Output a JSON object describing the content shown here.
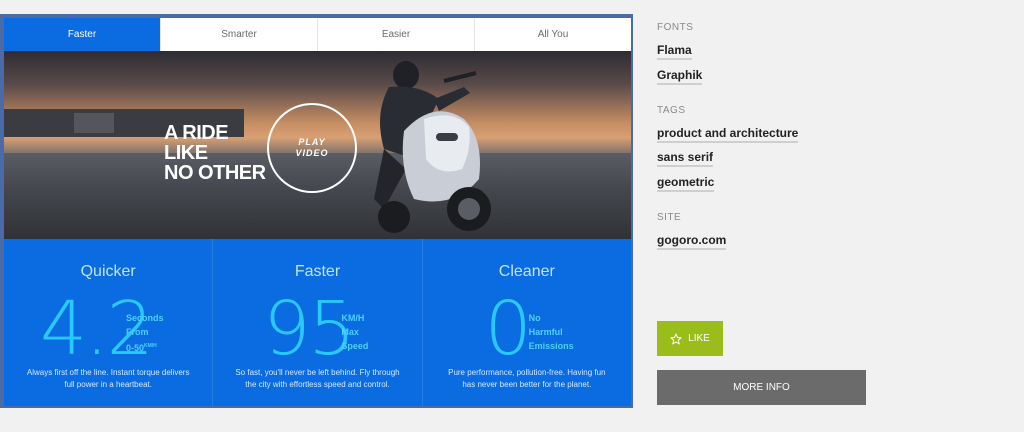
{
  "preview": {
    "tabs": [
      "Faster",
      "Smarter",
      "Easier",
      "All You"
    ],
    "active_tab_index": 0,
    "hero": {
      "title_lines": [
        "A RIDE",
        "LIKE",
        "NO OTHER"
      ],
      "play_label_lines": [
        "PLAY",
        "VIDEO"
      ]
    },
    "stats": [
      {
        "title": "Quicker",
        "number": "4.2",
        "unit_lines": [
          "Seconds",
          "From",
          "0-50"
        ],
        "unit_superscript": "KM/H",
        "description_lines": [
          "Always first off the line. Instant torque delivers",
          "full power in a heartbeat."
        ]
      },
      {
        "title": "Faster",
        "number": "95",
        "unit_lines": [
          "KM/H",
          "Max",
          "Speed"
        ],
        "description_lines": [
          "So fast, you'll never be left behind. Fly through",
          "the city with effortless speed and control."
        ]
      },
      {
        "title": "Cleaner",
        "number": "0",
        "unit_lines": [
          "No",
          "Harmful",
          "Emissions"
        ],
        "description_lines": [
          "Pure performance, pollution-free. Having fun",
          "has never been better for the planet."
        ]
      }
    ]
  },
  "sidebar": {
    "fonts_label": "FONTS",
    "fonts": [
      "Flama",
      "Graphik"
    ],
    "tags_label": "TAGS",
    "tags": [
      "product and architecture",
      "sans serif",
      "geometric"
    ],
    "site_label": "SITE",
    "site": "gogoro.com",
    "like_label": "LIKE",
    "like_icon": "star-outline-icon",
    "more_info_label": "MORE INFO"
  },
  "colors": {
    "brand_blue": "#0b6be0",
    "stat_cyan": "#29c8ff",
    "like_green": "#9bbd1c",
    "more_info_gray": "#6b6b6b"
  }
}
